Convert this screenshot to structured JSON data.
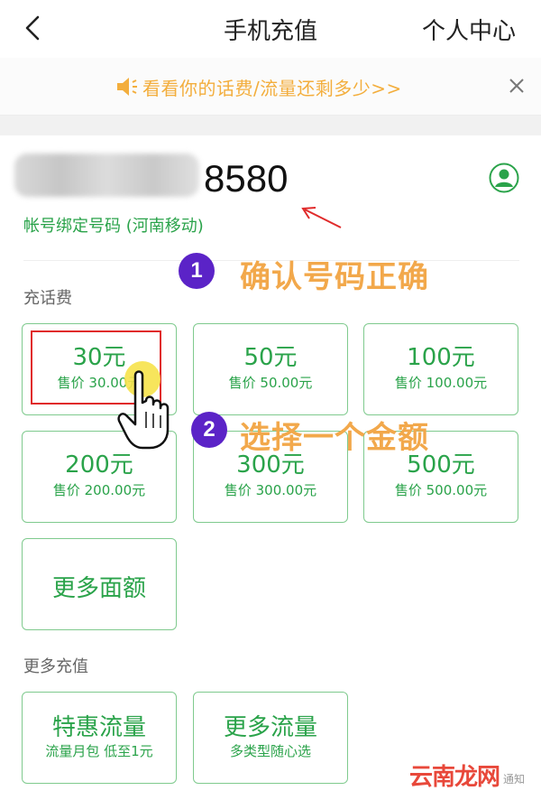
{
  "header": {
    "title": "手机充值",
    "user_center": "个人中心"
  },
  "notice": {
    "text": "看看你的话费/流量还剩多少>>",
    "close": "×"
  },
  "account": {
    "phone_tail": "8580",
    "bind_label": "帐号绑定号码 (河南移动)"
  },
  "annotations": {
    "step1_number": "1",
    "step1_text": "确认号码正确",
    "step2_number": "2",
    "step2_text": "选择一个金额"
  },
  "recharge": {
    "section_label": "充话费",
    "tiles": [
      {
        "amount": "30元",
        "price": "售价 30.00元"
      },
      {
        "amount": "50元",
        "price": "售价 50.00元"
      },
      {
        "amount": "100元",
        "price": "售价 100.00元"
      },
      {
        "amount": "200元",
        "price": "售价 200.00元"
      },
      {
        "amount": "300元",
        "price": "售价 300.00元"
      },
      {
        "amount": "500元",
        "price": "售价 500.00元"
      }
    ],
    "more_amounts": "更多面额"
  },
  "more": {
    "section_label": "更多充值",
    "tiles": [
      {
        "title": "特惠流量",
        "sub": "流量月包 低至1元"
      },
      {
        "title": "更多流量",
        "sub": "多类型随心选"
      }
    ]
  },
  "watermark": {
    "brand": "云南龙网",
    "small": "通知"
  },
  "colors": {
    "accent_green": "#2aa34a",
    "notice_orange": "#f3ae3d",
    "badge_purple": "#5b23c7",
    "annotation_orange": "#f2a84b",
    "highlight_red": "#e02a2a"
  }
}
